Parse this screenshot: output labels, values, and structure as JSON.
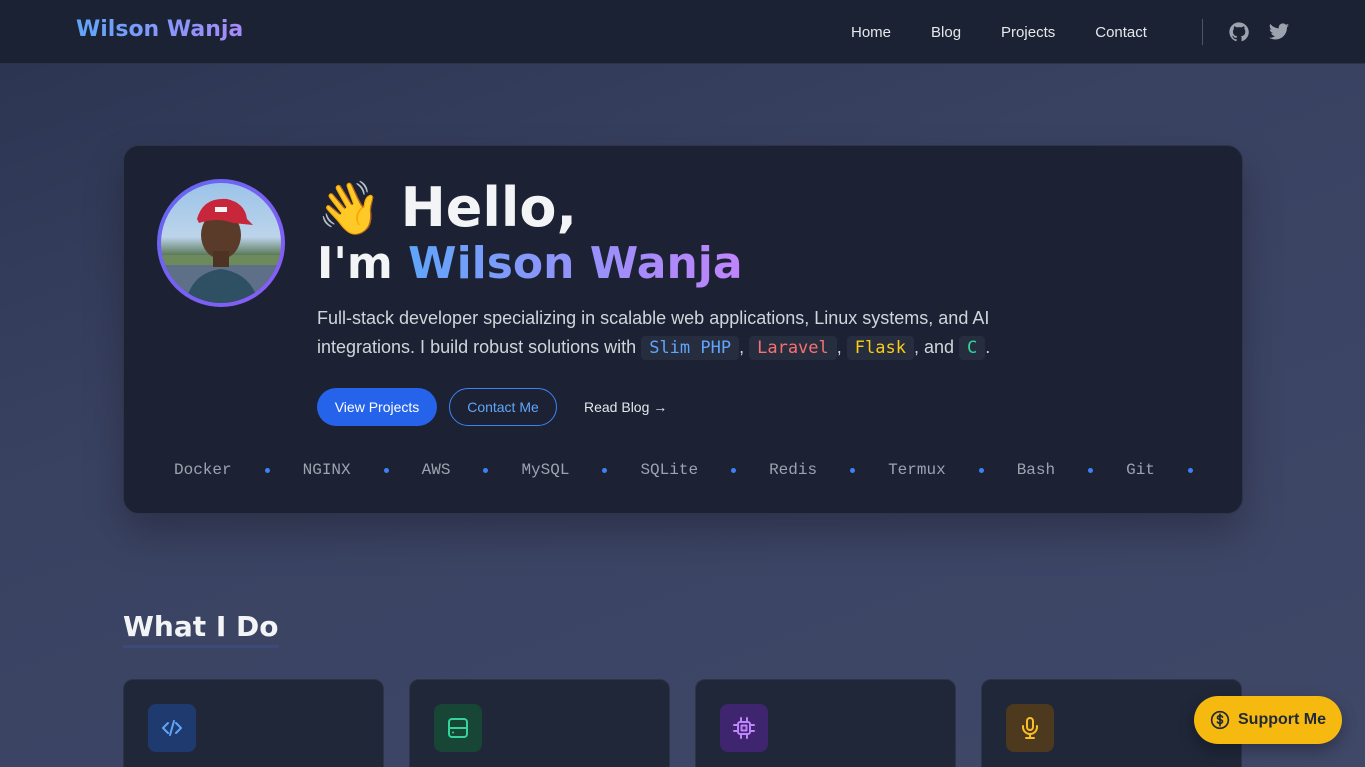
{
  "header": {
    "brand": "Wilson Wanja",
    "nav": [
      "Home",
      "Blog",
      "Projects",
      "Contact"
    ]
  },
  "hero": {
    "wave_emoji": "👋",
    "greeting": "Hello,",
    "im_prefix": "I'm",
    "name": "Wilson Wanja",
    "description_prefix": "Full-stack developer specializing in scalable web applications, Linux systems, and AI integrations. I build robust solutions with",
    "languages": [
      {
        "label": "Slim PHP",
        "color": "#60a5fa"
      },
      {
        "label": "Laravel",
        "color": "#f87171"
      },
      {
        "label": "Flask",
        "color": "#facc15"
      },
      {
        "label": "C",
        "color": "#34d399"
      }
    ],
    "and_word": "and",
    "buttons": {
      "primary": "View Projects",
      "outline": "Contact Me",
      "link": "Read Blog →"
    },
    "tech_stack": [
      "Docker",
      "NGINX",
      "AWS",
      "MySQL",
      "SQLite",
      "Redis",
      "Termux",
      "Bash",
      "Git"
    ]
  },
  "section": {
    "title": "What I Do"
  },
  "cards": [
    {
      "icon": "code-icon",
      "icon_color": "#60a5fa",
      "icon_bg": "#1e3a6e"
    },
    {
      "icon": "server-icon",
      "icon_color": "#34d399",
      "icon_bg": "#174536"
    },
    {
      "icon": "cpu-icon",
      "icon_color": "#c084fc",
      "icon_bg": "#3f2470"
    },
    {
      "icon": "microphone-icon",
      "icon_color": "#fbbf24",
      "icon_bg": "#4d3a1e"
    }
  ],
  "support": {
    "label": "Support Me",
    "icon": "dollar-icon",
    "color": "#f5b90f"
  }
}
